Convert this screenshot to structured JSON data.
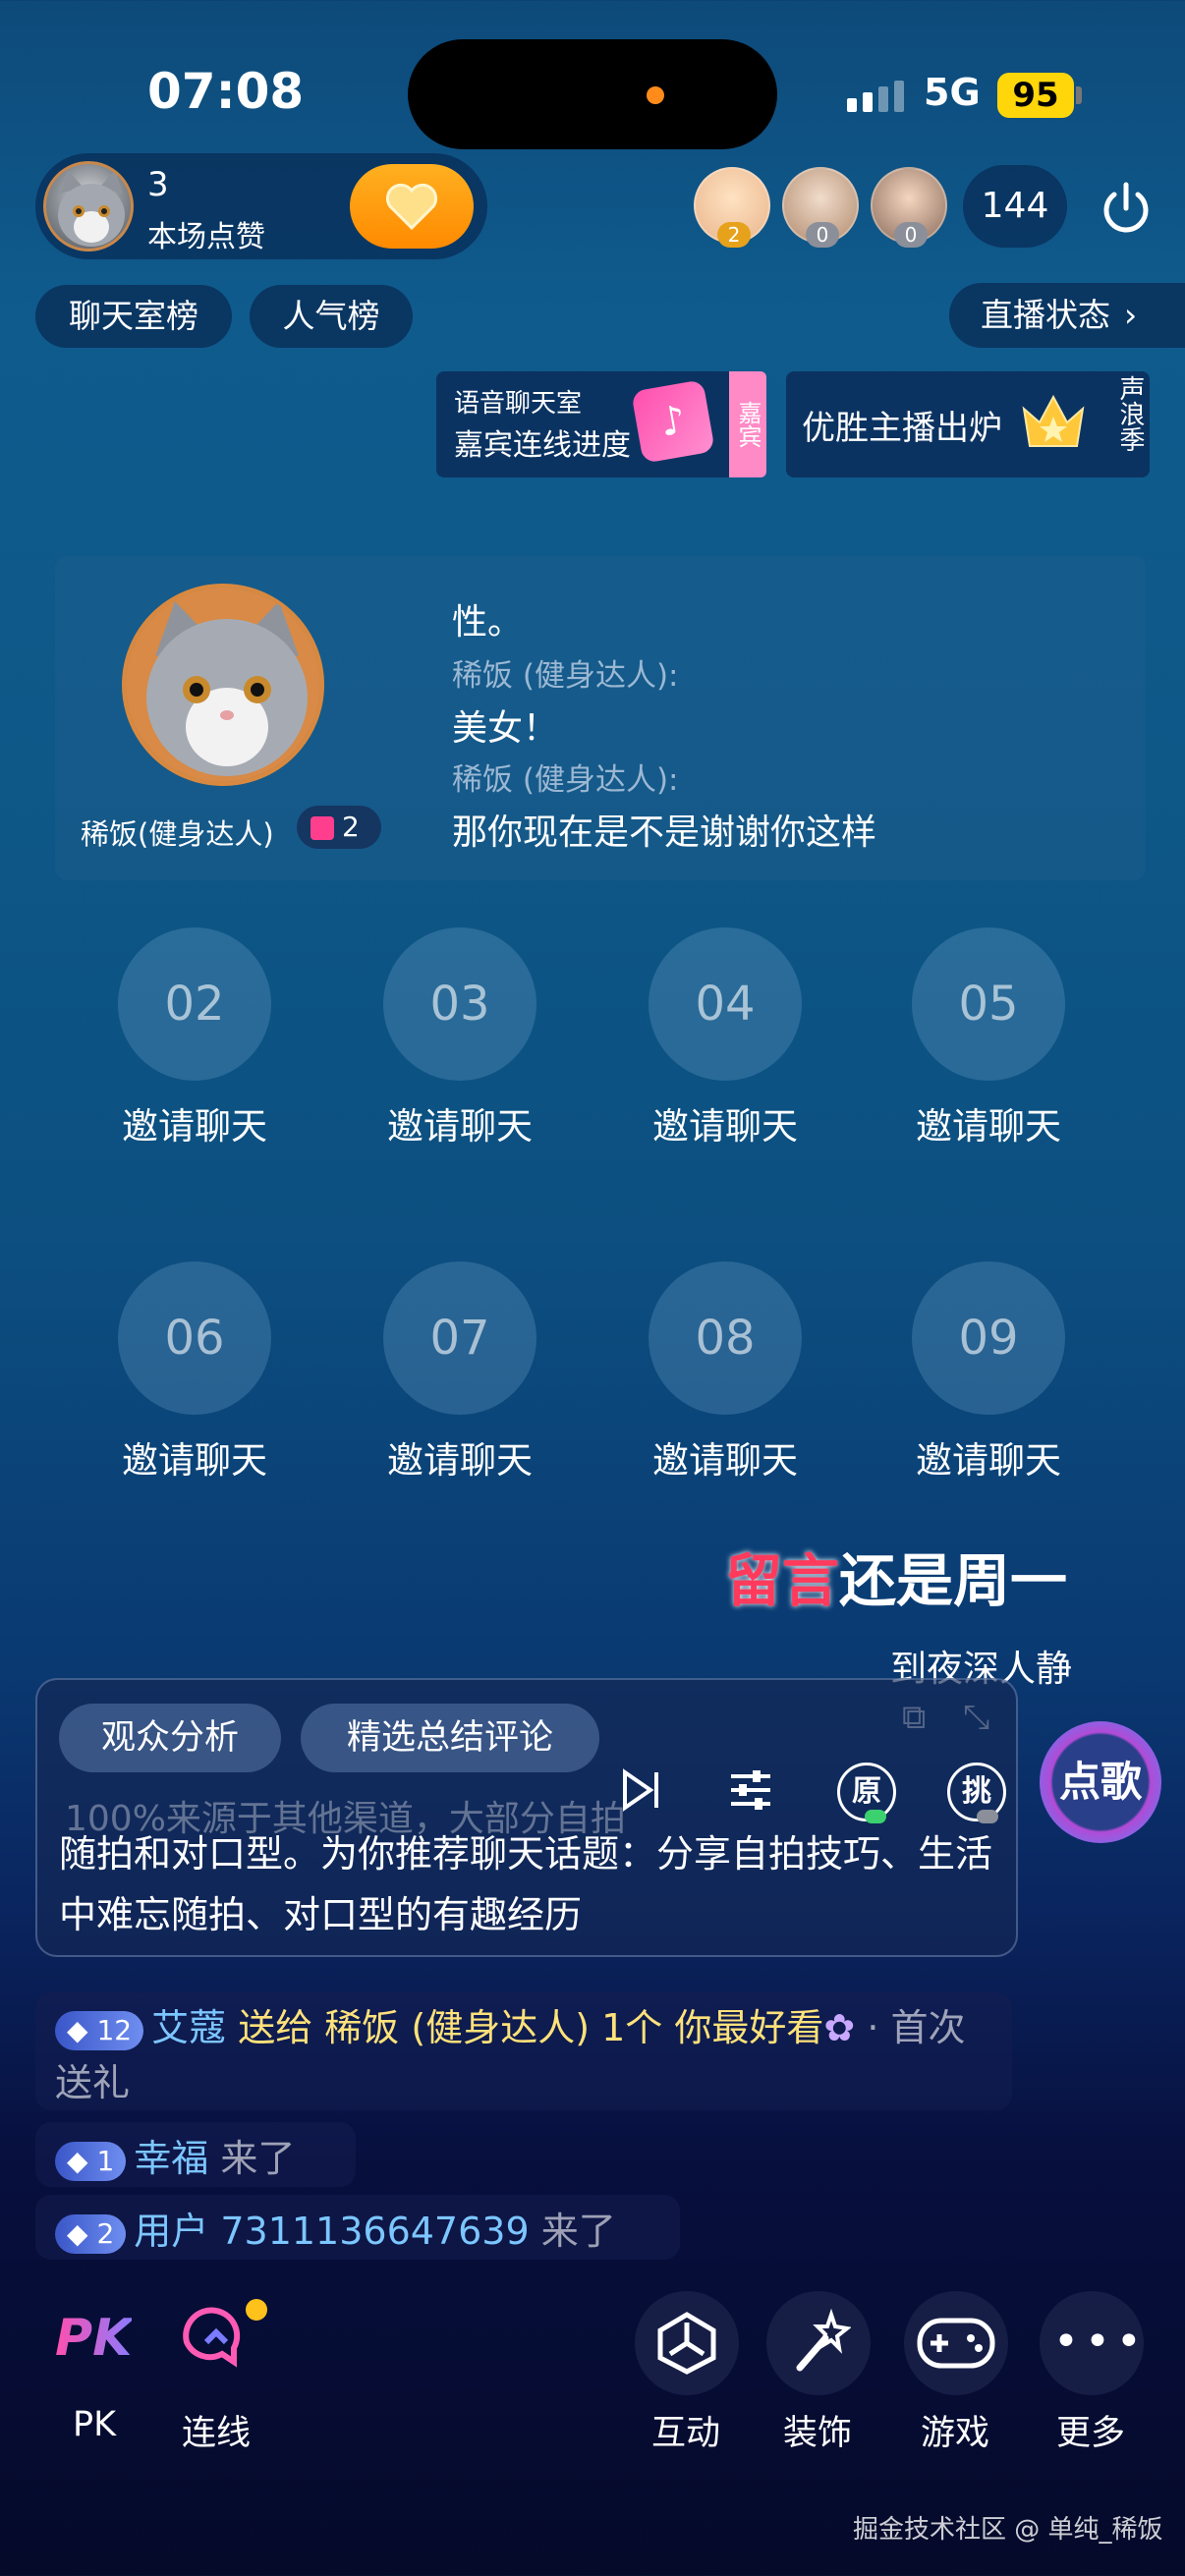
{
  "status_bar": {
    "time": "07:08",
    "network": "5G",
    "battery": "95"
  },
  "host": {
    "likes_count": "3",
    "likes_label": "本场点赞"
  },
  "viewers": [
    {
      "badge": "2"
    },
    {
      "badge": "0"
    },
    {
      "badge": "0"
    }
  ],
  "viewer_count": "144",
  "rank_tabs": [
    "聊天室榜",
    "人气榜"
  ],
  "live_status_label": "直播状态",
  "banners": {
    "voice_title": "语音聊天室",
    "voice_progress": "嘉宾连线进度",
    "voice_tag": "嘉宾",
    "best_host": "优胜主播出炉",
    "season_tag": "声浪季"
  },
  "chat": {
    "speaker_name": "稀饭(健身达人)",
    "gift_count": "2",
    "lines": [
      {
        "type": "text",
        "text": "性。"
      },
      {
        "type": "user",
        "text": "稀饭 (健身达人):"
      },
      {
        "type": "text",
        "text": "美女！"
      },
      {
        "type": "user",
        "text": "稀饭 (健身达人):"
      },
      {
        "type": "text",
        "text": "那你现在是不是谢谢你这样"
      }
    ]
  },
  "seats": [
    {
      "num": "02",
      "label": "邀请聊天"
    },
    {
      "num": "03",
      "label": "邀请聊天"
    },
    {
      "num": "04",
      "label": "邀请聊天"
    },
    {
      "num": "05",
      "label": "邀请聊天"
    },
    {
      "num": "06",
      "label": "邀请聊天"
    },
    {
      "num": "07",
      "label": "邀请聊天"
    },
    {
      "num": "08",
      "label": "邀请聊天"
    },
    {
      "num": "09",
      "label": "邀请聊天"
    }
  ],
  "lyrics": {
    "highlight": "留言",
    "rest": "还是周一",
    "next": "到夜深人静"
  },
  "analysis": {
    "tabs": [
      "观众分析",
      "精选总结评论"
    ],
    "cut_text": "100%来源于其他渠道，大部分自拍",
    "text": "随拍和对口型。为你推荐聊天话题：分享自拍技巧、生活中难忘随拍、对口型的有趣经历"
  },
  "player": {
    "original_label": "原",
    "challenge_label": "挑",
    "song_button": "点歌"
  },
  "messages": {
    "gift": {
      "level": "12",
      "user": "艾蔻",
      "action": "送给",
      "target": "稀饭 (健身达人) 1个 你最好看",
      "suffix": "· 首次送礼"
    },
    "join1": {
      "level": "1",
      "user": "幸福",
      "action": "来了"
    },
    "join2": {
      "level": "2",
      "user": "用户 7311136647639",
      "action": "来了"
    }
  },
  "bottom_bar": {
    "pk": "PK",
    "pk_label": "PK",
    "connect_label": "连线",
    "interact_label": "互动",
    "decorate_label": "装饰",
    "game_label": "游戏",
    "more_label": "更多"
  },
  "watermark": "掘金技术社区 @ 单纯_稀饭",
  "colors": {
    "accent": "#ffa000",
    "gift_pink": "#ff3f8e",
    "user_blue": "#7cc6ff",
    "gold": "#ffe27a"
  }
}
